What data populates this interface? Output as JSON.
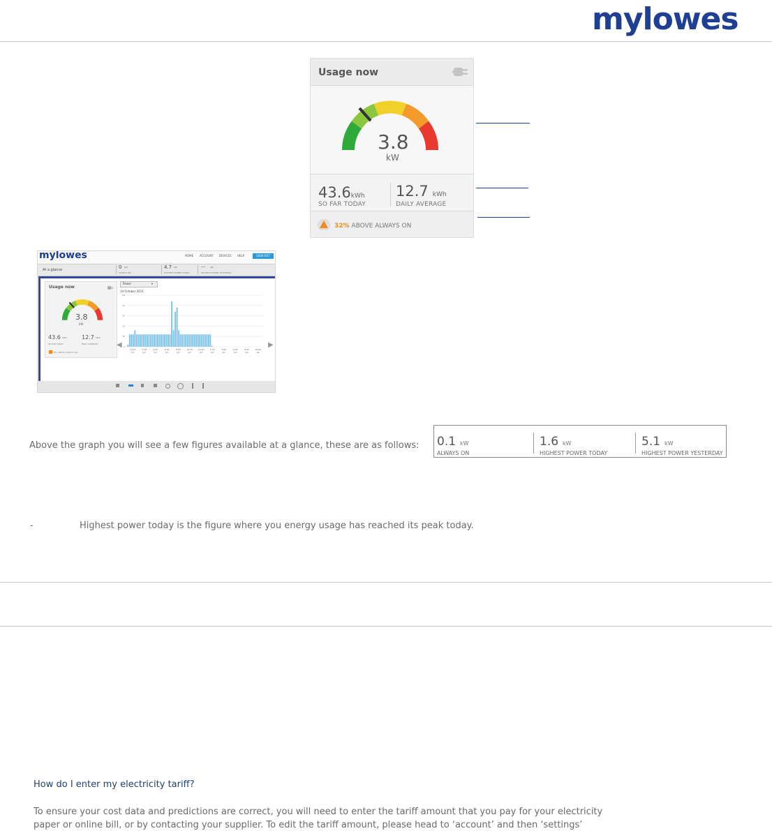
{
  "header": {
    "logo_text": "mylowes"
  },
  "widget": {
    "title": "Usage now",
    "gauge_value": "3.8",
    "gauge_unit": "kW",
    "so_far_value": "43.6",
    "so_far_unit": "kWh",
    "so_far_label": "SO FAR TODAY",
    "daily_value": "12.7",
    "daily_unit": "kWh",
    "daily_label": "DAILY AVERAGE",
    "alert_pct": "32%",
    "alert_text": "ABOVE ALWAYS ON"
  },
  "thumbnail": {
    "logo_text": "mylowes",
    "nav": [
      "HOME",
      "ACCOUNT",
      "DEVICES",
      "HELP"
    ],
    "sign_out": "SIGN OUT",
    "glance_label": "At a glance",
    "glance_items": [
      {
        "value": "0",
        "unit": "kW",
        "label": "ALWAYS ON"
      },
      {
        "value": "4.7",
        "unit": "kW",
        "label": "HIGHEST POWER TODAY"
      },
      {
        "value": "---",
        "unit": "kW",
        "label": "HIGHEST POWER YESTERDAY"
      }
    ],
    "panel_title": "Usage now",
    "gauge_value": "3.8",
    "gauge_unit": "kW",
    "so_far_value": "43.6",
    "so_far_unit": "kWh",
    "so_far_label": "SO FAR TODAY",
    "daily_value": "12.7",
    "daily_unit": "kWh",
    "daily_label": "DAILY AVERAGE",
    "alert_text": "8% ABOVE ALWAYS ON",
    "select_value": "Power",
    "date": "14 October 2011",
    "colors": {
      "accent": "#2f4a9c",
      "bars": "#7ec3ea"
    },
    "chart_data": {
      "type": "bar",
      "xlabels": [
        "12:00 pm",
        "2:00 pm",
        "4:00 pm",
        "6:00 pm",
        "8:00 pm",
        "10:00 pm",
        "12:00 am",
        "2:00 am",
        "4:00 am",
        "6:00 am",
        "8:00 am",
        "10:00 am"
      ],
      "yticks": [
        "0",
        "10",
        "20",
        "30",
        "40",
        "50"
      ],
      "ylim": [
        0,
        50
      ],
      "values": [
        2,
        12,
        12,
        12,
        16,
        12,
        12,
        12,
        12,
        12,
        12,
        12,
        12,
        12,
        12,
        12,
        12,
        12,
        12,
        12,
        12,
        12,
        12,
        12,
        12,
        44,
        16,
        34,
        38,
        16,
        12,
        12,
        12,
        12,
        12,
        12,
        12,
        12,
        12,
        12,
        12,
        12,
        12,
        12,
        12,
        12,
        12,
        12,
        1,
        0,
        0,
        0,
        0,
        0,
        0,
        0,
        0,
        0,
        0,
        0,
        0,
        0,
        0,
        0,
        0,
        0,
        0,
        0,
        0,
        0,
        0,
        0,
        0,
        0,
        0,
        0,
        0,
        0
      ]
    }
  },
  "glance": {
    "items": [
      {
        "value": "0.1",
        "unit": "kW",
        "label": "ALWAYS ON"
      },
      {
        "value": "1.6",
        "unit": "kW",
        "label": "HIGHEST POWER TODAY"
      },
      {
        "value": "5.1",
        "unit": "kW",
        "label": "HIGHEST POWER YESTERDAY"
      }
    ]
  },
  "text": {
    "glance_intro": "Above the graph you will see a few figures available at a glance, these are as follows:",
    "bullet_dash": "-",
    "bullet_text": "Highest power today is the figure where you energy usage has reached its peak today.",
    "tariff_heading": "How do I enter my electricity tariff?",
    "tariff_line1": "To ensure your cost data and predictions are correct, you will need to enter the tariff amount that you pay for your electricity",
    "tariff_line2": "paper or online bill, or by contacting your supplier. To edit the tariff amount, please head to ‘account’ and then ‘settings’"
  }
}
